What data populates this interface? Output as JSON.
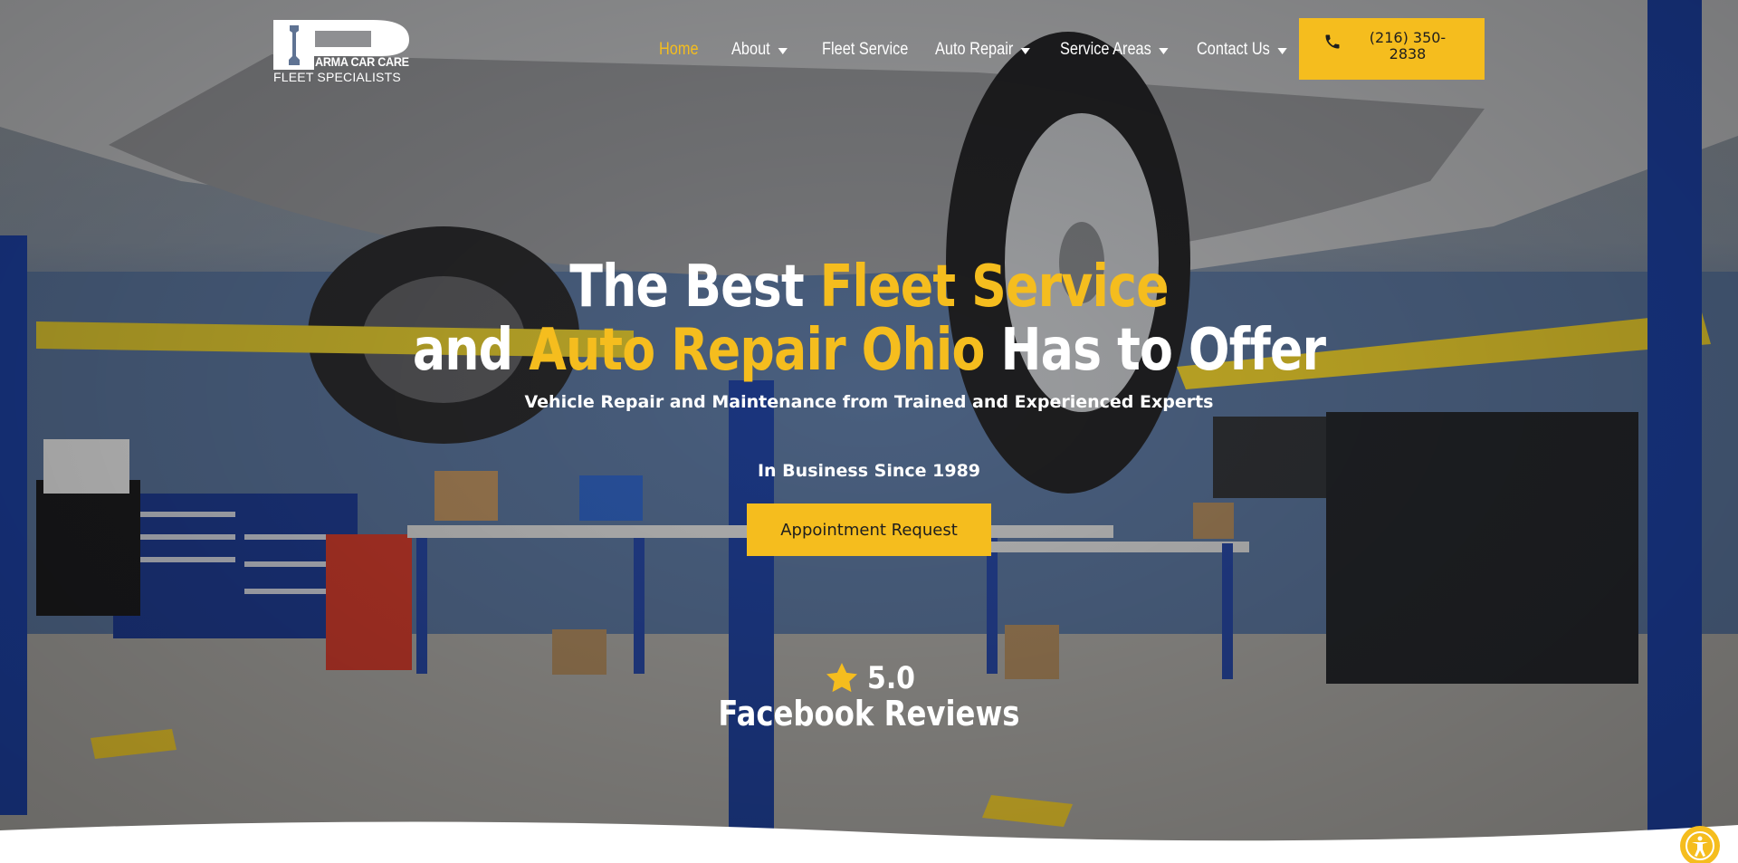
{
  "brand": {
    "logo_main": "ARMA CAR CARE",
    "logo_sub": "FLEET SPECIALISTS"
  },
  "nav": {
    "items": [
      {
        "label": "Home",
        "active": true,
        "has_dropdown": false
      },
      {
        "label": "About",
        "active": false,
        "has_dropdown": true
      },
      {
        "label": "Fleet Service",
        "active": false,
        "has_dropdown": false
      },
      {
        "label": "Auto Repair",
        "active": false,
        "has_dropdown": true
      },
      {
        "label": "Service Areas",
        "active": false,
        "has_dropdown": true
      },
      {
        "label": "Contact Us",
        "active": false,
        "has_dropdown": true
      }
    ]
  },
  "phone": {
    "label": "(216) 350-2838",
    "icon": "phone-icon"
  },
  "hero": {
    "headline_part1": "The Best ",
    "headline_highlight1": "Fleet Service",
    "headline_part2": "and ",
    "headline_highlight2": "Auto Repair Ohio",
    "headline_part3": " Has to Offer",
    "subheading": "Vehicle Repair and Maintenance from Trained and Experienced Experts",
    "since": "In Business Since 1989",
    "cta_label": "Appointment Request"
  },
  "reviews": {
    "score": "5.0",
    "label": "Facebook Reviews",
    "icon": "star-icon"
  },
  "colors": {
    "accent": "#f5bd1e",
    "text_light": "#ffffff",
    "text_dark": "#1e1e1e"
  },
  "accessibility": {
    "icon": "accessibility-icon"
  }
}
